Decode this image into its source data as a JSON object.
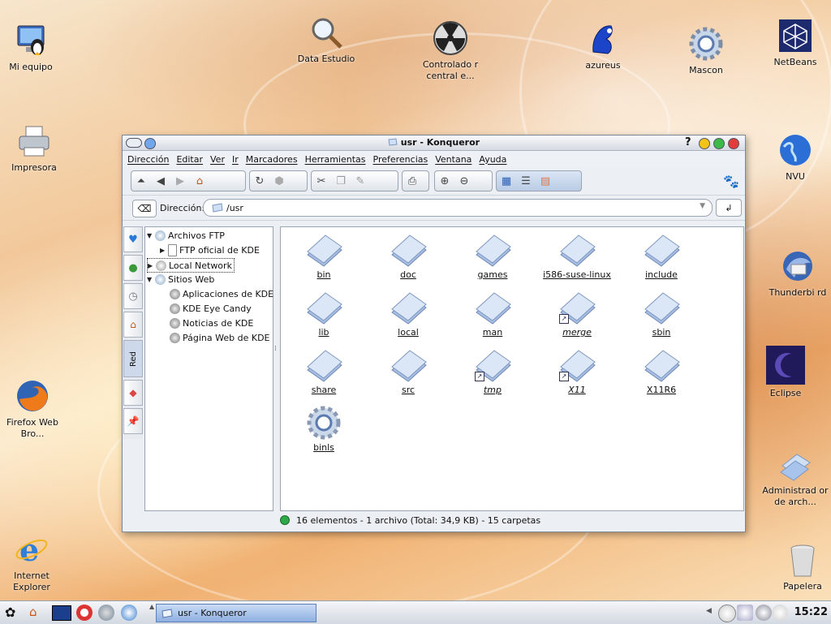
{
  "desktop": {
    "icons": [
      {
        "label": "Mi equipo",
        "icon": "computer-icon"
      },
      {
        "label": "Impresora",
        "icon": "printer-icon"
      },
      {
        "label": "Firefox Web Bro...",
        "icon": "firefox-icon"
      },
      {
        "label": "Internet Explorer",
        "icon": "ie-icon"
      },
      {
        "label": "Data Estudio",
        "icon": "magnifier-icon"
      },
      {
        "label": "Controlado r central e...",
        "icon": "radiation-icon"
      },
      {
        "label": "azureus",
        "icon": "frog-icon"
      },
      {
        "label": "Mascon",
        "icon": "gear-icon"
      },
      {
        "label": "NetBeans",
        "icon": "cube-icon"
      },
      {
        "label": "NVU",
        "icon": "globe-icon"
      },
      {
        "label": "Thunderbi rd",
        "icon": "thunderbird-icon"
      },
      {
        "label": "Eclipse",
        "icon": "eclipse-icon"
      },
      {
        "label": "Administrad or de arch...",
        "icon": "folders-icon"
      },
      {
        "label": "Papelera",
        "icon": "trash-icon"
      }
    ]
  },
  "window": {
    "title": "usr - Konqueror",
    "help": "?",
    "menu": [
      "Dirección",
      "Editar",
      "Ver",
      "Ir",
      "Marcadores",
      "Herramientas",
      "Preferencias",
      "Ventana",
      "Ayuda"
    ],
    "address_label": "Dirección:",
    "address_value": "/usr",
    "sidebar_tab_label": "Red",
    "tree": [
      {
        "label": "Archivos FTP",
        "expanded": true,
        "level": 0
      },
      {
        "label": "FTP oficial de KDE",
        "expanded": false,
        "level": 1
      },
      {
        "label": "Local Network",
        "expanded": false,
        "level": 0
      },
      {
        "label": "Sitios Web",
        "expanded": true,
        "level": 0
      },
      {
        "label": "Aplicaciones de KDE",
        "level": 1
      },
      {
        "label": "KDE Eye Candy",
        "level": 1
      },
      {
        "label": "Noticias de KDE",
        "level": 1
      },
      {
        "label": "Página Web de KDE",
        "level": 1
      }
    ],
    "files": [
      {
        "name": "bin",
        "kind": "folder"
      },
      {
        "name": "doc",
        "kind": "folder"
      },
      {
        "name": "games",
        "kind": "folder"
      },
      {
        "name": "i586-suse-linux",
        "kind": "folder"
      },
      {
        "name": "include",
        "kind": "folder"
      },
      {
        "name": "lib",
        "kind": "folder"
      },
      {
        "name": "local",
        "kind": "folder"
      },
      {
        "name": "man",
        "kind": "folder"
      },
      {
        "name": "merge",
        "kind": "link"
      },
      {
        "name": "sbin",
        "kind": "folder"
      },
      {
        "name": "share",
        "kind": "folder"
      },
      {
        "name": "src",
        "kind": "folder"
      },
      {
        "name": "tmp",
        "kind": "link"
      },
      {
        "name": "X11",
        "kind": "link"
      },
      {
        "name": "X11R6",
        "kind": "folder"
      },
      {
        "name": "binls",
        "kind": "file"
      }
    ],
    "status": "16 elementos - 1 archivo (Total: 34,9 KB) - 15 carpetas"
  },
  "taskbar": {
    "task_label": "usr - Konqueror",
    "clock": "15:22"
  },
  "colors": {
    "accent": "#7aa0e0",
    "status_ok": "#2fa84a"
  }
}
